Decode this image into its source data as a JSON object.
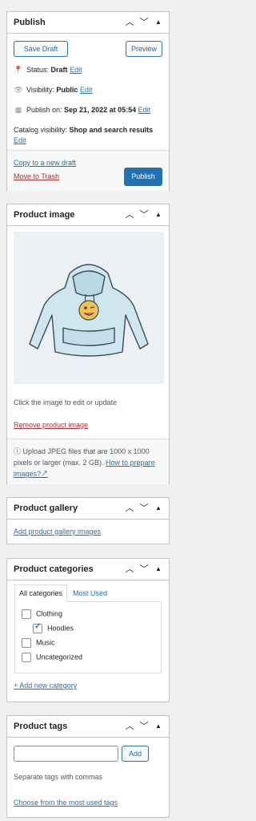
{
  "publish": {
    "title": "Publish",
    "save_draft": "Save Draft",
    "preview": "Preview",
    "status_label": "Status:",
    "status_value": "Draft",
    "visibility_label": "Visibility:",
    "visibility_value": "Public",
    "published_label": "Publish on:",
    "published_value": "Sep 21, 2022 at 05:54",
    "edit": "Edit",
    "catalog_label": "Catalog visibility:",
    "catalog_value": "Shop and search results",
    "copy_link": "Copy to a new draft",
    "trash_link": "Move to Trash",
    "publish_button": "Publish"
  },
  "product_image": {
    "title": "Product image",
    "help": "Click the image to edit or update",
    "remove": "Remove product image",
    "upload_note": "Upload JPEG files that are 1000 x 1000 pixels or larger (max. 2 GB).",
    "upload_link": "How to prepare images?"
  },
  "gallery": {
    "title": "Product gallery",
    "add_link": "Add product gallery images"
  },
  "categories": {
    "title": "Product categories",
    "tab_all": "All categories",
    "tab_used": "Most Used",
    "items": [
      {
        "label": "Clothing",
        "checked": false,
        "indent": false
      },
      {
        "label": "Hoodies",
        "checked": true,
        "indent": true
      },
      {
        "label": "Music",
        "checked": false,
        "indent": false
      },
      {
        "label": "Uncategorized",
        "checked": false,
        "indent": false
      }
    ],
    "add_link": "+ Add new category"
  },
  "tags": {
    "title": "Product tags",
    "add_button": "Add",
    "input_value": "",
    "hint": "Separate tags with commas",
    "choose_link": "Choose from the most used tags"
  },
  "colors": {
    "accent": "#2271b1",
    "danger": "#b32d2e",
    "border": "#c3c4c7"
  }
}
